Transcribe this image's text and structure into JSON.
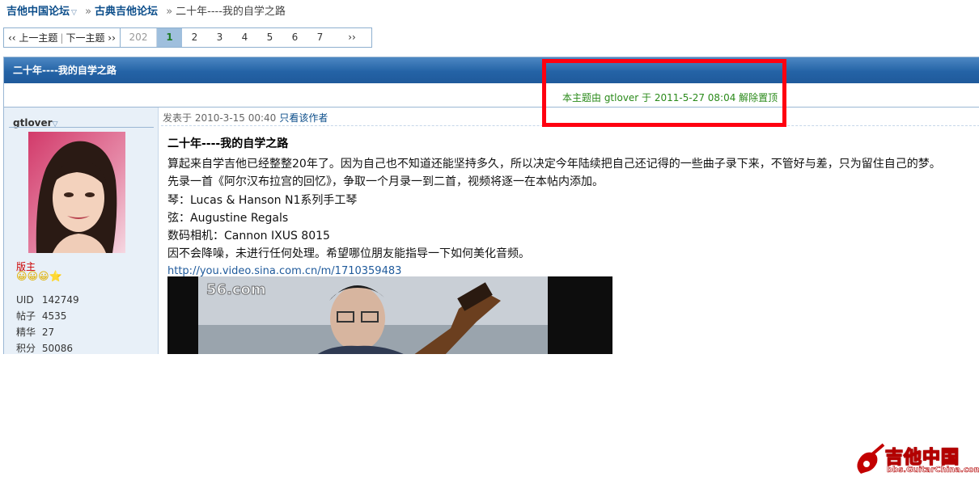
{
  "breadcrumb": {
    "forum": "吉他中国论坛",
    "separator": "»",
    "subforum": "古典吉他论坛",
    "current": "二十年----我的自学之路"
  },
  "nav": {
    "prev": "‹‹ 上一主题",
    "divider": "|",
    "next": "下一主题 ››"
  },
  "pagination": {
    "total": "202",
    "pages": [
      "1",
      "2",
      "3",
      "4",
      "5",
      "6",
      "7"
    ],
    "current": "1",
    "next": "››"
  },
  "thread": {
    "title": "二十年----我的自学之路",
    "notice": "本主题由 gtlover 于 2011-5-27 08:04 解除置顶"
  },
  "author": {
    "name": "gtlover",
    "rank": "版主",
    "stars": "😀😀😀⭐",
    "stats": [
      {
        "label": "UID",
        "value": "142749"
      },
      {
        "label": "帖子",
        "value": "4535"
      },
      {
        "label": "精华",
        "value": "27"
      },
      {
        "label": "积分",
        "value": "50086"
      }
    ]
  },
  "post": {
    "posted_at": "发表于 2010-3-15 00:40",
    "only_author": "只看该作者",
    "title": "二十年----我的自学之路",
    "lines": [
      "算起来自学吉他已经整整20年了。因为自己也不知道还能坚持多久，所以决定今年陆续把自己还记得的一些曲子录下来，不管好与差，只为留住自己的梦。",
      "先录一首《阿尔汉布拉宫的回忆》，争取一个月录一到二首，视频将逐一在本帖内添加。",
      "琴：Lucas & Hanson N1系列手工琴",
      "弦：Augustine Regals",
      "数码相机：Cannon IXUS 8015",
      "因不会降噪，未进行任何处理。希望哪位朋友能指导一下如何美化音频。"
    ],
    "link": "http://you.video.sina.com.cn/m/1710359483",
    "video_logo": "56.com"
  },
  "watermark": {
    "cn": "吉他中国",
    "en": "bbs.GuitarChina.com"
  },
  "colors": {
    "title_bar": "#2463a6",
    "highlight": "#ff0010",
    "notice_text": "#2a8a1a",
    "rank_text": "#cc0000"
  }
}
